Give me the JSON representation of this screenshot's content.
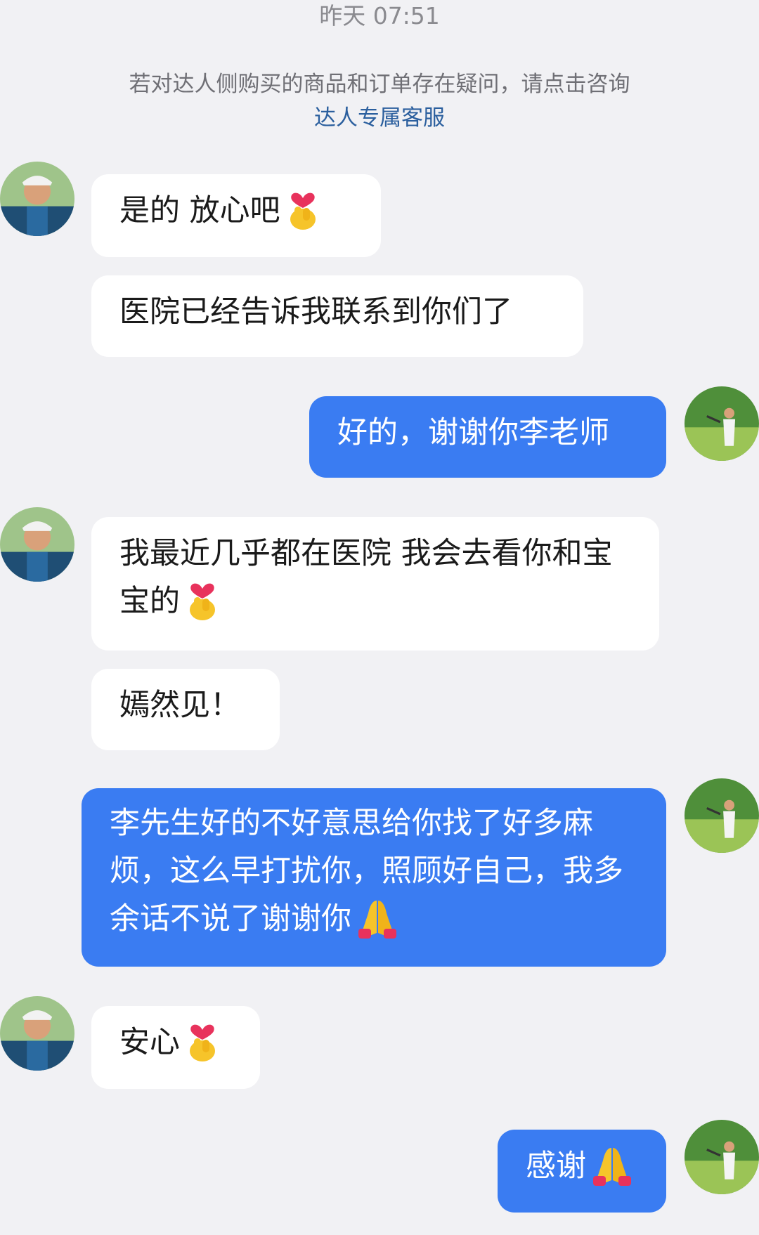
{
  "timestamp": "昨天 07:51",
  "notice": {
    "text": "若对达人侧购买的商品和订单存在疑问，请点击咨询",
    "link": "达人专属客服"
  },
  "messages": [
    {
      "text": "是的 放心吧",
      "emoji": "finger-heart-icon"
    },
    {
      "text": "医院已经告诉我联系到你们了"
    },
    {
      "text": "好的，谢谢你李老师"
    },
    {
      "text": "我最近几乎都在医院 我会去看你和宝宝的",
      "emoji": "finger-heart-icon"
    },
    {
      "text": "嫣然见！"
    },
    {
      "text": "李先生好的不好意思给你找了好多麻烦，这么早打扰你，照顾好自己，我多余话不说了谢谢你",
      "emoji": "folded-hands-icon"
    },
    {
      "text": "安心",
      "emoji": "finger-heart-icon"
    },
    {
      "text": "感谢",
      "emoji": "folded-hands-icon"
    }
  ],
  "colors": {
    "background": "#f1f1f4",
    "incoming_bubble": "#ffffff",
    "outgoing_bubble": "#3a7cf2",
    "link": "#2b5f9e"
  }
}
